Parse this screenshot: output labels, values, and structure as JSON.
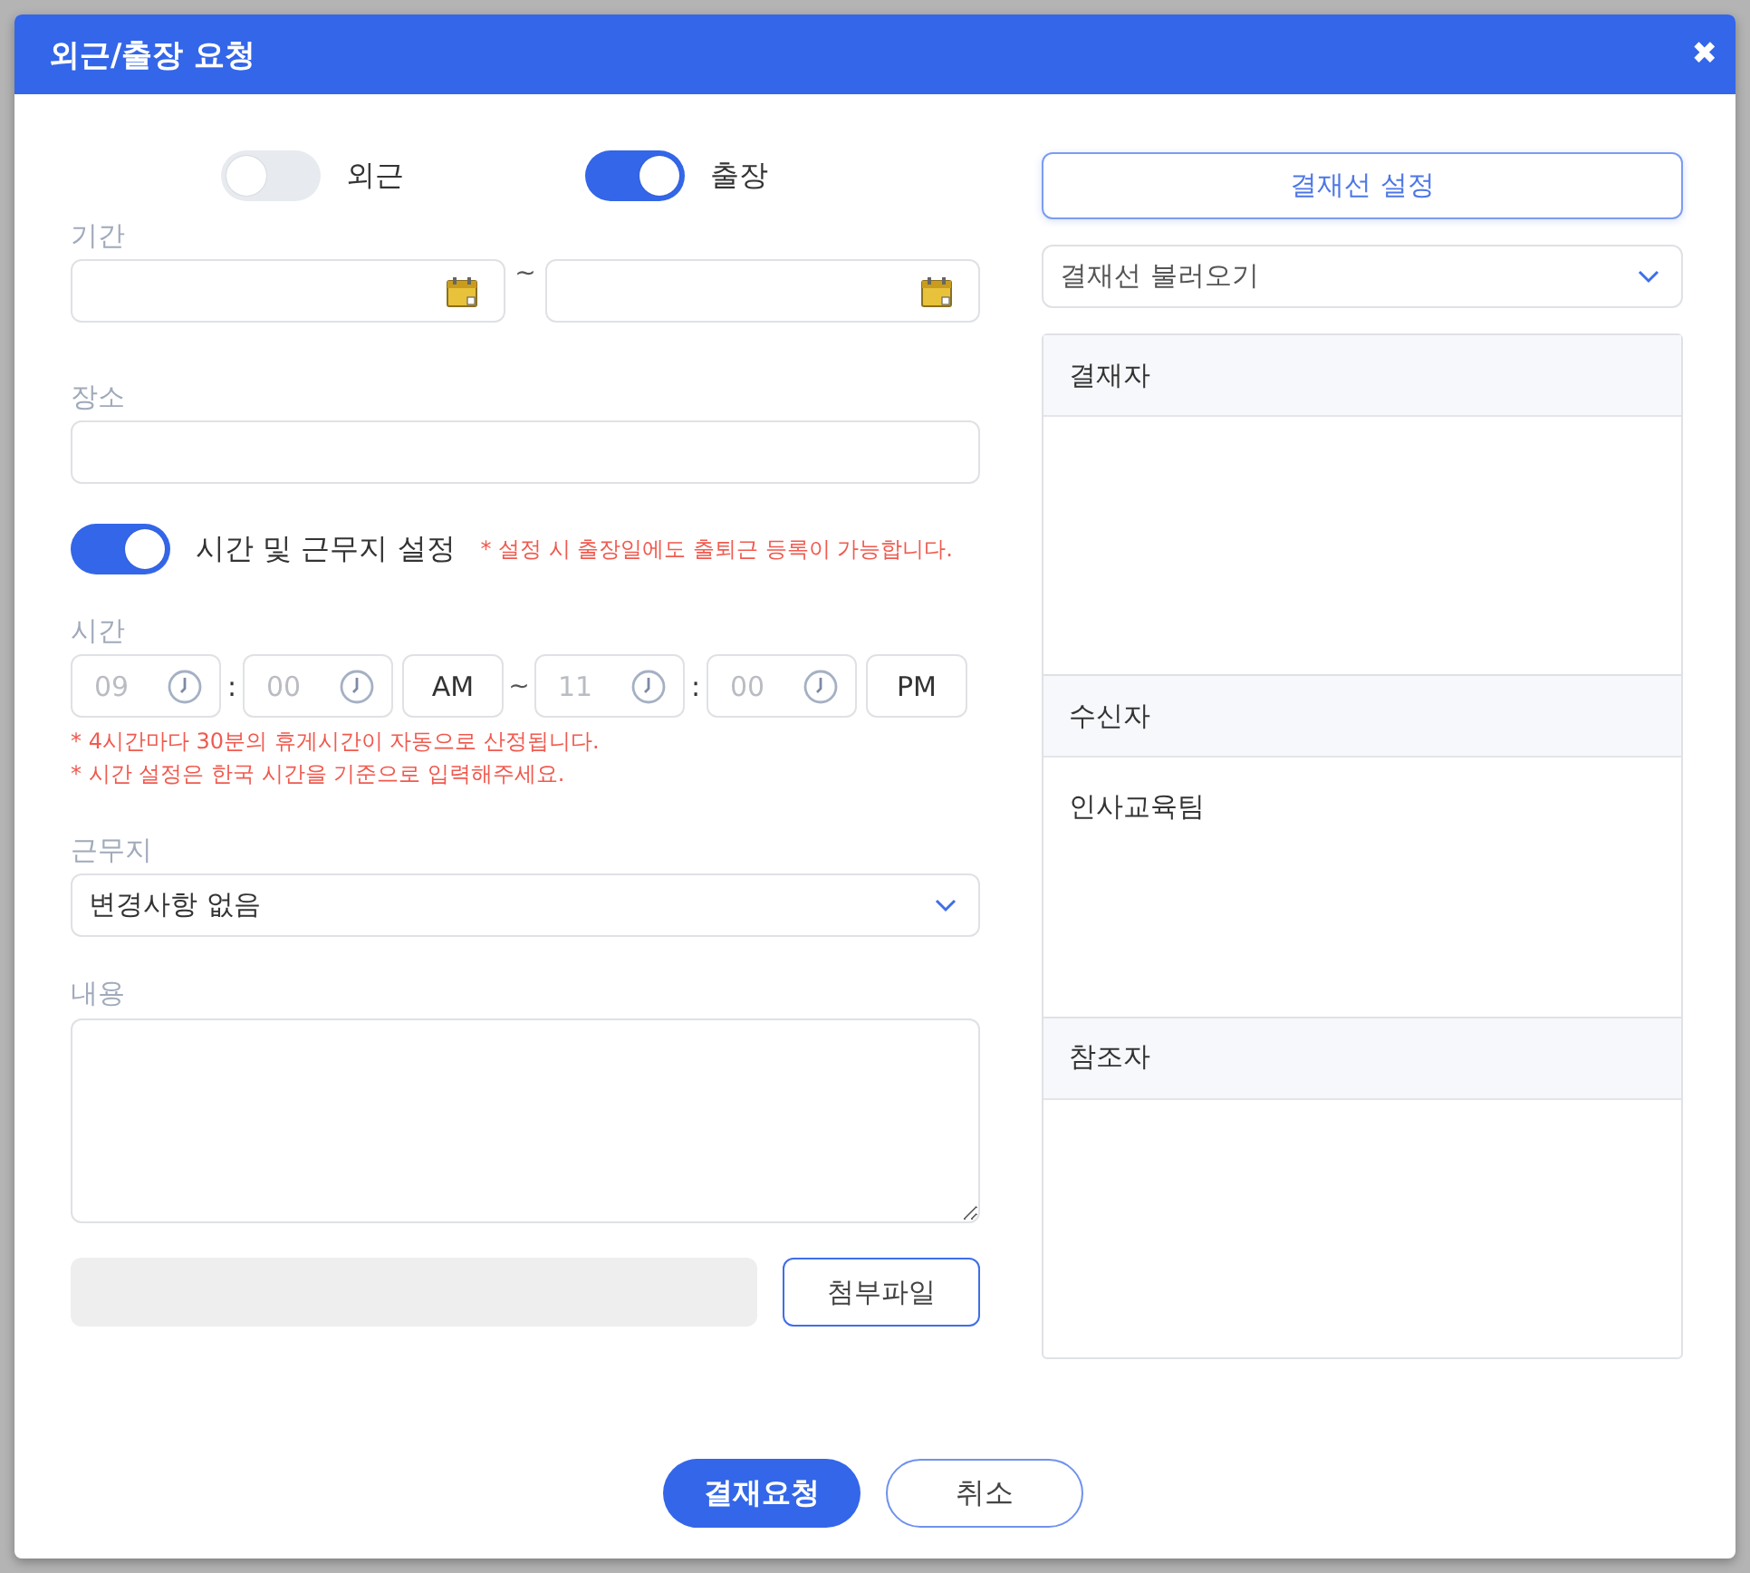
{
  "dialog": {
    "title": "외근/출장 요청",
    "close": "✖"
  },
  "type_toggles": [
    {
      "label": "외근",
      "on": false
    },
    {
      "label": "출장",
      "on": true
    }
  ],
  "period": {
    "label": "기간",
    "separator": "~"
  },
  "place": {
    "label": "장소"
  },
  "time_setting": {
    "label": "시간 및 근무지 설정",
    "on": true,
    "note": "* 설정 시 출장일에도 출퇴근 등록이 가능합니다."
  },
  "time": {
    "label": "시간",
    "separator": "~",
    "start": {
      "hour": {
        "placeholder": "09"
      },
      "colon": ":",
      "minute": {
        "placeholder": "00"
      },
      "meridiem": "AM"
    },
    "end": {
      "hour": {
        "placeholder": "11"
      },
      "colon": ":",
      "minute": {
        "placeholder": "00"
      },
      "meridiem": "PM"
    },
    "notes": [
      "* 4시간마다 30분의 휴게시간이 자동으로 산정됩니다.",
      "* 시간 설정은 한국 시간을 기준으로 입력해주세요."
    ]
  },
  "workplace": {
    "label": "근무지",
    "value": "변경사항 없음"
  },
  "content": {
    "label": "내용"
  },
  "attachment": {
    "button": "첨부파일"
  },
  "approval": {
    "setup_button": "결재선 설정",
    "load_select": "결재선 불러오기",
    "sections": [
      {
        "title": "결재자"
      },
      {
        "title": "수신자",
        "entries": [
          "인사교육팀"
        ]
      },
      {
        "title": "참조자"
      }
    ]
  },
  "footer": {
    "buttons": [
      {
        "label": "결재요청",
        "kind": "primary"
      },
      {
        "label": "취소",
        "kind": "secondary"
      }
    ]
  }
}
